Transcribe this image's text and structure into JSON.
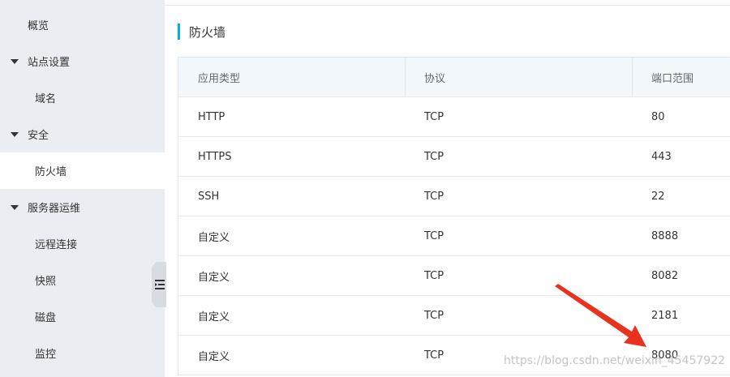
{
  "sidebar": {
    "overview": "概览",
    "site_settings": "站点设置",
    "domain": "域名",
    "security": "安全",
    "firewall": "防火墙",
    "server_ops": "服务器运维",
    "remote": "远程连接",
    "snapshot": "快照",
    "disk": "磁盘",
    "monitor": "监控"
  },
  "section": {
    "title": "防火墙"
  },
  "table": {
    "headers": [
      "应用类型",
      "协议",
      "端口范围"
    ],
    "rows": [
      [
        "HTTP",
        "TCP",
        "80"
      ],
      [
        "HTTPS",
        "TCP",
        "443"
      ],
      [
        "SSH",
        "TCP",
        "22"
      ],
      [
        "自定义",
        "TCP",
        "8888"
      ],
      [
        "自定义",
        "TCP",
        "8082"
      ],
      [
        "自定义",
        "TCP",
        "2181"
      ],
      [
        "自定义",
        "TCP",
        "8080"
      ]
    ]
  },
  "watermark": "https://blog.csdn.net/weixin_45457922",
  "colors": {
    "accent": "#00b0d6",
    "arrow": "#e8321e",
    "sidebar_bg": "#eaedf1"
  },
  "icons": {
    "collapse": "collapse-sidebar-icon",
    "expand_caret": "caret-down-icon"
  }
}
